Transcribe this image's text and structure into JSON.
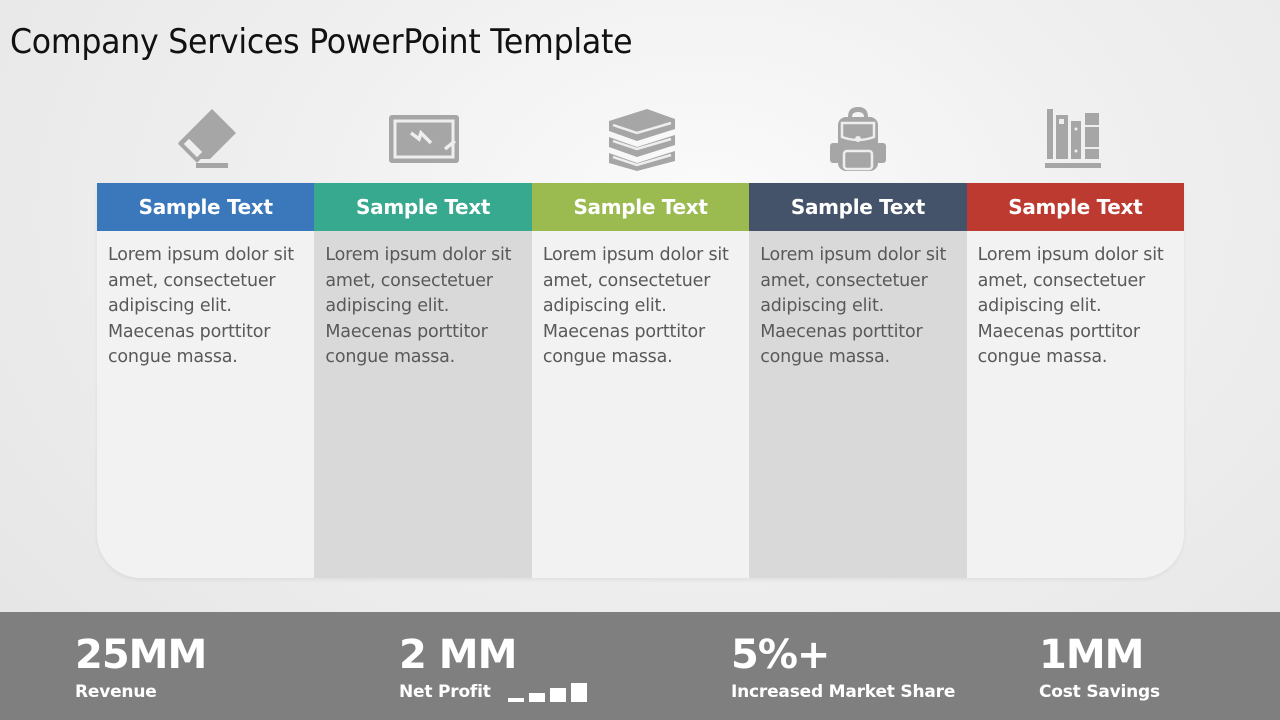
{
  "title": "Company Services PowerPoint Template",
  "columns": [
    {
      "icon": "eraser-icon",
      "heading": "Sample Text",
      "color": "#3a78bb",
      "body": "Lorem ipsum dolor sit amet, consectetuer adipiscing elit. Maecenas porttitor congue massa."
    },
    {
      "icon": "chalkboard-icon",
      "heading": "Sample Text",
      "color": "#36a98e",
      "body": "Lorem ipsum dolor sit amet, consectetuer adipiscing elit. Maecenas porttitor congue massa."
    },
    {
      "icon": "books-stack-icon",
      "heading": "Sample Text",
      "color": "#9bbb50",
      "body": "Lorem ipsum dolor sit amet, consectetuer adipiscing elit. Maecenas porttitor congue massa."
    },
    {
      "icon": "backpack-icon",
      "heading": "Sample Text",
      "color": "#445369",
      "body": "Lorem ipsum dolor sit amet, consectetuer adipiscing elit. Maecenas porttitor congue massa."
    },
    {
      "icon": "bookshelf-icon",
      "heading": "Sample Text",
      "color": "#bd3a30",
      "body": "Lorem ipsum dolor sit amet, consectetuer adipiscing elit. Maecenas porttitor congue massa."
    }
  ],
  "stats": [
    {
      "value": "25MM",
      "label": "Revenue"
    },
    {
      "value": "2 MM",
      "label": "Net Profit",
      "trend_icon": "growth-bars-icon"
    },
    {
      "value": "5%+",
      "label": "Increased Market Share"
    },
    {
      "value": "1MM",
      "label": "Cost Savings"
    }
  ]
}
